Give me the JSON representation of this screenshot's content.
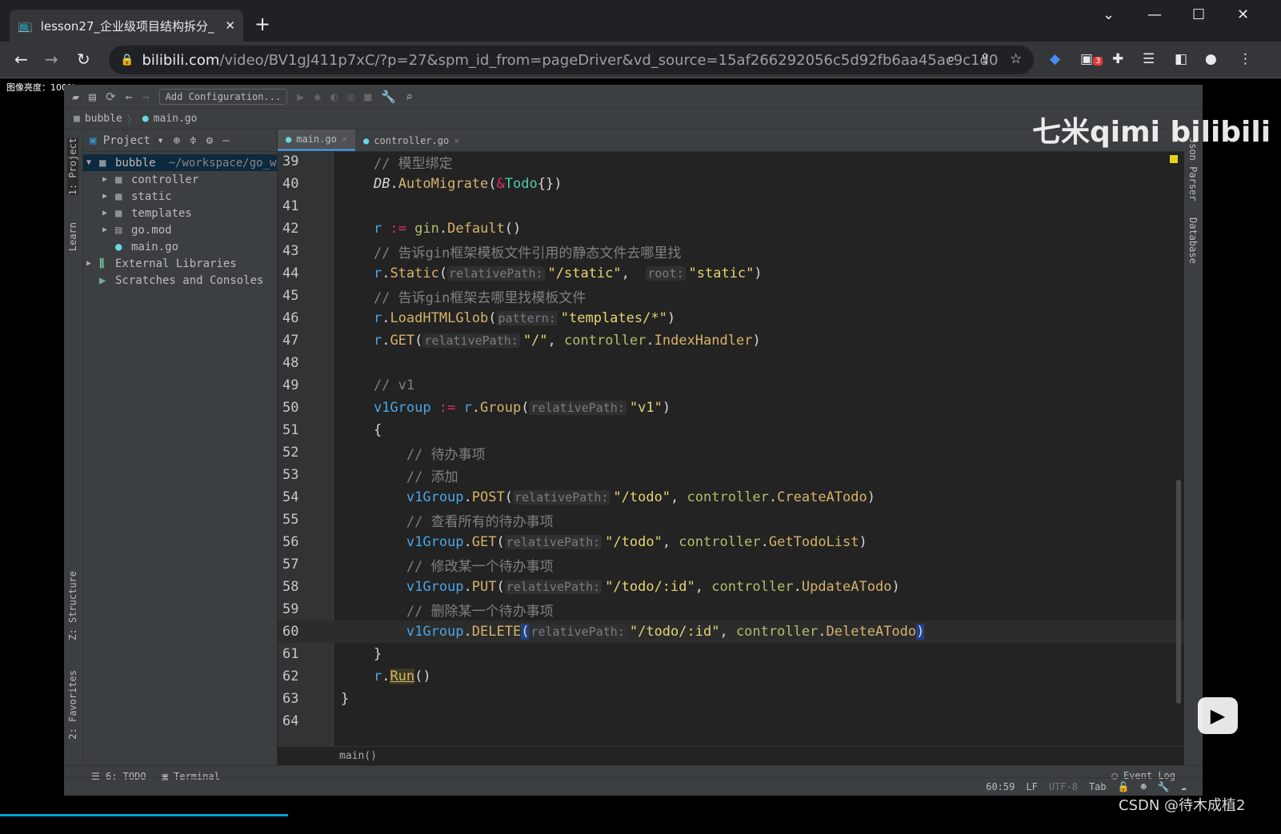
{
  "browser": {
    "tab_title": "lesson27_企业级项目结构拆分_",
    "url_domain": "bilibili.com",
    "url_path": "/video/BV1gJ411p7xC/?p=27&spm_id_from=pageDriver&vd_source=15af266292056c5d92fb6aa45ac9c1d0",
    "extension_badge": "3"
  },
  "overlay": {
    "brightness": "图像亮度：100%",
    "watermark": "七米qimi bilibili",
    "csdn": "CSDN @待木成植2"
  },
  "ide": {
    "toolbar": {
      "add_config": "Add Configuration..."
    },
    "breadcrumb": [
      "bubble",
      "main.go"
    ],
    "left_strip": {
      "project": "1: Project",
      "learn": "Learn",
      "structure": "Z: Structure",
      "favorites": "2: Favorites"
    },
    "right_strip": {
      "parser": "Json Parser",
      "database": "Database"
    },
    "project": {
      "header": "Project",
      "tree": [
        {
          "label": "bubble",
          "extra": "~/workspace/go_w",
          "depth": 0,
          "expanded": true,
          "icon": "folder-icon"
        },
        {
          "label": "controller",
          "depth": 1,
          "icon": "folder-icon"
        },
        {
          "label": "static",
          "depth": 1,
          "icon": "folder-icon"
        },
        {
          "label": "templates",
          "depth": 1,
          "icon": "folder-icon"
        },
        {
          "label": "go.mod",
          "depth": 1,
          "icon": "file-icon"
        },
        {
          "label": "main.go",
          "depth": 1,
          "icon": "gopher-icon"
        },
        {
          "label": "External Libraries",
          "depth": 0,
          "icon": "library-icon"
        },
        {
          "label": "Scratches and Consoles",
          "depth": 0,
          "icon": "scratch-icon"
        }
      ]
    },
    "tabs": [
      {
        "label": "main.go",
        "active": true
      },
      {
        "label": "controller.go",
        "active": false
      }
    ],
    "current_line": "60",
    "lines": [
      {
        "num": "39",
        "tokens": [
          [
            "c",
            "    // 模型绑定"
          ]
        ]
      },
      {
        "num": "40",
        "tokens": [
          [
            "n",
            "    "
          ],
          [
            "i",
            "DB"
          ],
          [
            "n",
            "."
          ],
          [
            "f",
            "AutoMigrate"
          ],
          [
            "n",
            "("
          ],
          [
            "o",
            "&"
          ],
          [
            "k",
            "Todo"
          ],
          [
            "n",
            "{})"
          ]
        ]
      },
      {
        "num": "41",
        "tokens": []
      },
      {
        "num": "42",
        "tokens": [
          [
            "v",
            "    r "
          ],
          [
            "o",
            ":="
          ],
          [
            "n",
            " "
          ],
          [
            "p",
            "gin"
          ],
          [
            "n",
            "."
          ],
          [
            "f",
            "Default"
          ],
          [
            "n",
            "()"
          ]
        ]
      },
      {
        "num": "43",
        "tokens": [
          [
            "c",
            "    // 告诉gin框架模板文件引用的静态文件去哪里找"
          ]
        ]
      },
      {
        "num": "44",
        "tokens": [
          [
            "v",
            "    r"
          ],
          [
            "n",
            "."
          ],
          [
            "f",
            "Static"
          ],
          [
            "n",
            "("
          ],
          [
            "h",
            "relativePath:"
          ],
          [
            "s",
            "\"/static\""
          ],
          [
            "n",
            ",  "
          ],
          [
            "h",
            "root:"
          ],
          [
            "s",
            "\"static\""
          ],
          [
            "n",
            ")"
          ]
        ]
      },
      {
        "num": "45",
        "tokens": [
          [
            "c",
            "    // 告诉gin框架去哪里找模板文件"
          ]
        ]
      },
      {
        "num": "46",
        "tokens": [
          [
            "v",
            "    r"
          ],
          [
            "n",
            "."
          ],
          [
            "f",
            "LoadHTMLGlob"
          ],
          [
            "n",
            "("
          ],
          [
            "h",
            "pattern:"
          ],
          [
            "s",
            "\"templates/*\""
          ],
          [
            "n",
            ")"
          ]
        ]
      },
      {
        "num": "47",
        "tokens": [
          [
            "v",
            "    r"
          ],
          [
            "n",
            "."
          ],
          [
            "f",
            "GET"
          ],
          [
            "n",
            "("
          ],
          [
            "h",
            "relativePath:"
          ],
          [
            "s",
            "\"/\""
          ],
          [
            "n",
            ", "
          ],
          [
            "p",
            "controller"
          ],
          [
            "n",
            "."
          ],
          [
            "f",
            "IndexHandler"
          ],
          [
            "n",
            ")"
          ]
        ]
      },
      {
        "num": "48",
        "tokens": []
      },
      {
        "num": "49",
        "tokens": [
          [
            "c",
            "    // v1"
          ]
        ]
      },
      {
        "num": "50",
        "tokens": [
          [
            "v",
            "    v1Group "
          ],
          [
            "o",
            ":="
          ],
          [
            "v",
            " r"
          ],
          [
            "n",
            "."
          ],
          [
            "f",
            "Group"
          ],
          [
            "n",
            "("
          ],
          [
            "h",
            "relativePath:"
          ],
          [
            "s",
            "\"v1\""
          ],
          [
            "n",
            ")"
          ]
        ]
      },
      {
        "num": "51",
        "tokens": [
          [
            "n",
            "    {"
          ]
        ]
      },
      {
        "num": "52",
        "tokens": [
          [
            "c",
            "        // 待办事项"
          ]
        ]
      },
      {
        "num": "53",
        "tokens": [
          [
            "c",
            "        // 添加"
          ]
        ]
      },
      {
        "num": "54",
        "tokens": [
          [
            "v",
            "        v1Group"
          ],
          [
            "n",
            "."
          ],
          [
            "f",
            "POST"
          ],
          [
            "n",
            "("
          ],
          [
            "h",
            "relativePath:"
          ],
          [
            "s",
            "\"/todo\""
          ],
          [
            "n",
            ", "
          ],
          [
            "p",
            "controller"
          ],
          [
            "n",
            "."
          ],
          [
            "f",
            "CreateATodo"
          ],
          [
            "n",
            ")"
          ]
        ]
      },
      {
        "num": "55",
        "tokens": [
          [
            "c",
            "        // 查看所有的待办事项"
          ]
        ]
      },
      {
        "num": "56",
        "tokens": [
          [
            "v",
            "        v1Group"
          ],
          [
            "n",
            "."
          ],
          [
            "f",
            "GET"
          ],
          [
            "n",
            "("
          ],
          [
            "h",
            "relativePath:"
          ],
          [
            "s",
            "\"/todo\""
          ],
          [
            "n",
            ", "
          ],
          [
            "p",
            "controller"
          ],
          [
            "n",
            "."
          ],
          [
            "f",
            "GetTodoList"
          ],
          [
            "n",
            ")"
          ]
        ]
      },
      {
        "num": "57",
        "tokens": [
          [
            "c",
            "        // 修改某一个待办事项"
          ]
        ]
      },
      {
        "num": "58",
        "tokens": [
          [
            "v",
            "        v1Group"
          ],
          [
            "n",
            "."
          ],
          [
            "f",
            "PUT"
          ],
          [
            "n",
            "("
          ],
          [
            "h",
            "relativePath:"
          ],
          [
            "s",
            "\"/todo/:id\""
          ],
          [
            "n",
            ", "
          ],
          [
            "p",
            "controller"
          ],
          [
            "n",
            "."
          ],
          [
            "f",
            "UpdateATodo"
          ],
          [
            "n",
            ")"
          ]
        ]
      },
      {
        "num": "59",
        "tokens": [
          [
            "c",
            "        // 删除某一个待办事项"
          ]
        ]
      },
      {
        "num": "60",
        "tokens": [
          [
            "v",
            "        v1Group"
          ],
          [
            "n",
            "."
          ],
          [
            "f",
            "DELETE"
          ],
          [
            "m",
            "("
          ],
          [
            "h",
            "relativePath:"
          ],
          [
            "s",
            "\"/todo/:id\""
          ],
          [
            "n",
            ", "
          ],
          [
            "p",
            "controller"
          ],
          [
            "n",
            "."
          ],
          [
            "f",
            "DeleteATodo"
          ],
          [
            "m",
            ")"
          ]
        ]
      },
      {
        "num": "61",
        "tokens": [
          [
            "n",
            "    }"
          ]
        ]
      },
      {
        "num": "62",
        "tokens": [
          [
            "v",
            "    r"
          ],
          [
            "n",
            "."
          ],
          [
            "u",
            "Run"
          ],
          [
            "n",
            "()"
          ]
        ]
      },
      {
        "num": "63",
        "tokens": [
          [
            "n",
            "}"
          ]
        ]
      },
      {
        "num": "64",
        "tokens": []
      }
    ],
    "function_crumb": "main()",
    "bottom_tabs": {
      "todo": "6: TODO",
      "terminal": "Terminal",
      "event_log": "Event Log"
    },
    "status": {
      "position": "60:59",
      "line_sep": "LF",
      "encoding": "UTF-8",
      "indent": "Tab"
    }
  }
}
